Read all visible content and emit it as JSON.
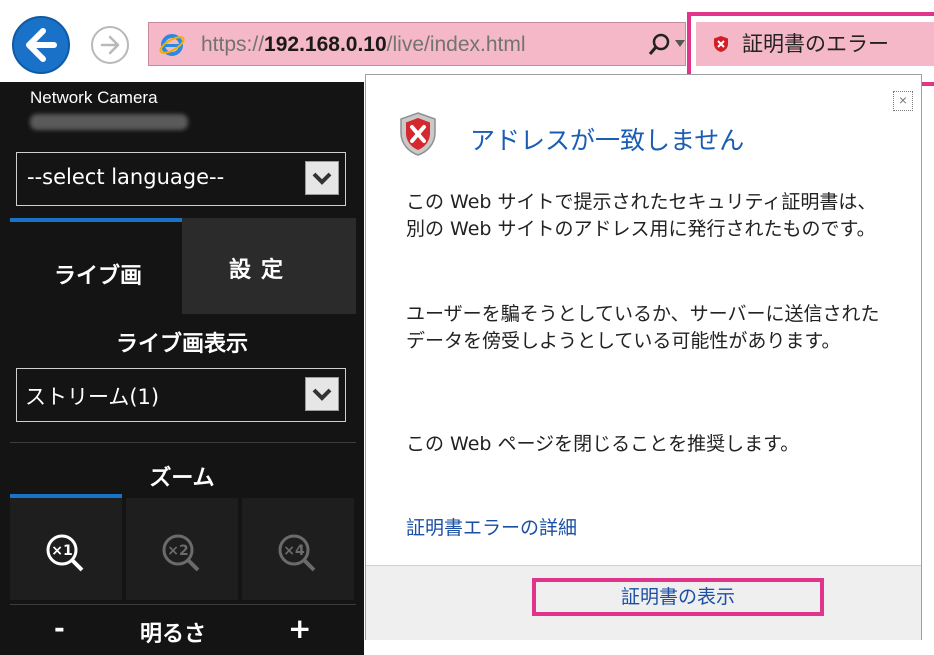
{
  "browser": {
    "url_scheme": "https://",
    "url_host": "192.168.0.10",
    "url_path": "/live/index.html",
    "cert_error_label": "証明書のエラー"
  },
  "camera": {
    "model_label": "Network Camera",
    "language_select": "--select language--",
    "tabs": {
      "live": "ライブ画",
      "settings": "設定"
    },
    "live_display_title": "ライブ画表示",
    "stream_select": "ストリーム(1)",
    "zoom_title": "ズーム",
    "zoom_buttons": [
      "×1",
      "×2",
      "×4"
    ],
    "brightness": {
      "minus": "-",
      "label": "明るさ",
      "plus": "+"
    }
  },
  "popup": {
    "title": "アドレスが一致しません",
    "message1": "この Web サイトで提示されたセキュリティ証明書は、別の Web サイトのアドレス用に発行されたものです。",
    "message2": "ユーザーを騙そうとしているか、サーバーに送信されたデータを傍受しようとしている可能性があります。",
    "message3": "この Web ページを閉じることを推奨します。",
    "details_link": "証明書エラーの詳細",
    "show_cert_button": "証明書の表示",
    "close": "×"
  },
  "colors": {
    "highlight": "#e0358b",
    "accent": "#1a72c8",
    "link": "#1a4fa3"
  }
}
